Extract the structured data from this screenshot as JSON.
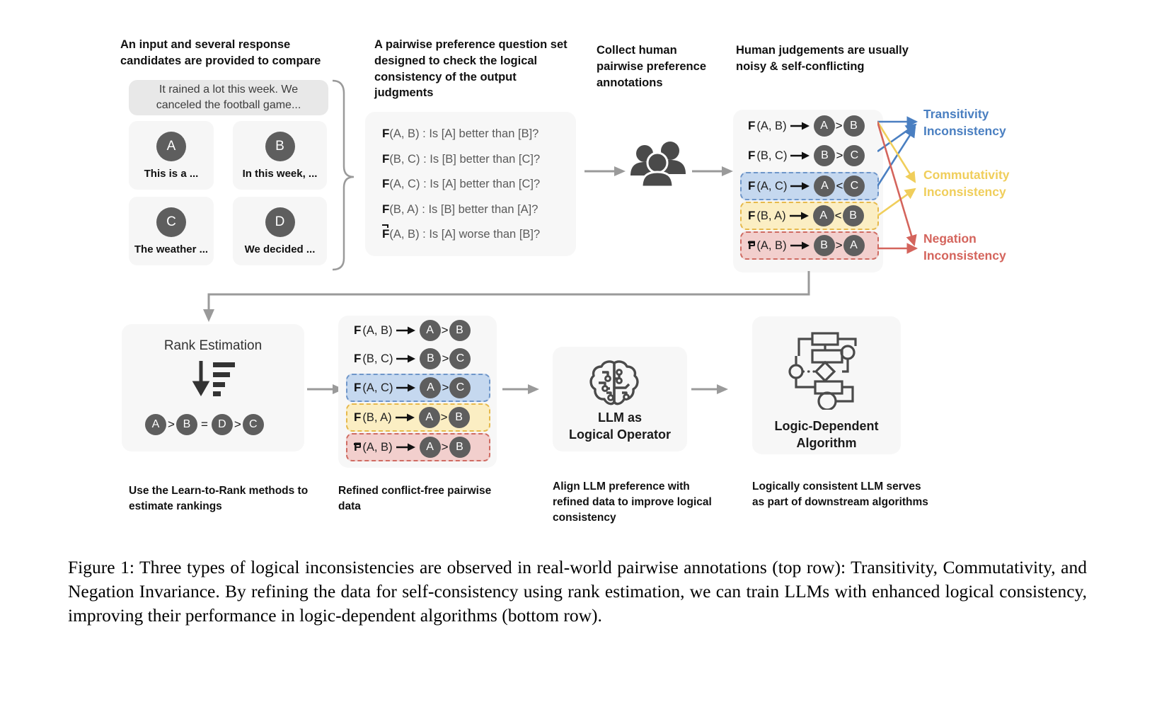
{
  "headers": {
    "input": "An input and several response candidates are provided to compare",
    "questions": "A pairwise preference question set designed to check the logical consistency of the output judgments",
    "collect": "Collect human pairwise preference annotations",
    "noisy": "Human judgements are usually noisy & self-conflicting"
  },
  "prompt": "It rained a lot this week. We canceled the football game...",
  "candidates": [
    {
      "letter": "A",
      "label": "This is a ..."
    },
    {
      "letter": "B",
      "label": "In this week, ..."
    },
    {
      "letter": "C",
      "label": "The weather ..."
    },
    {
      "letter": "D",
      "label": "We decided ..."
    }
  ],
  "question_set": [
    {
      "fn": "F",
      "negated": false,
      "args": "(A, B)",
      "sep": ":",
      "text": "Is [A] better than [B]?"
    },
    {
      "fn": "F",
      "negated": false,
      "args": "(B, C)",
      "sep": ":",
      "text": "Is [B] better than [C]?"
    },
    {
      "fn": "F",
      "negated": false,
      "args": "(A, C)",
      "sep": ":",
      "text": "Is [A] better than [C]?"
    },
    {
      "fn": "F",
      "negated": false,
      "args": "(B, A)",
      "sep": ":",
      "text": "Is [B] better than [A]?"
    },
    {
      "fn": "F",
      "negated": true,
      "args": "(A, B)",
      "sep": ":",
      "text": "Is [A] worse than [B]?"
    }
  ],
  "human_judgements": [
    {
      "fn": "F",
      "negated": false,
      "args": "(A, B)",
      "left": "A",
      "rel": ">",
      "right": "B",
      "highlight": "none"
    },
    {
      "fn": "F",
      "negated": false,
      "args": "(B, C)",
      "left": "B",
      "rel": ">",
      "right": "C",
      "highlight": "none"
    },
    {
      "fn": "F",
      "negated": false,
      "args": "(A, C)",
      "left": "A",
      "rel": "<",
      "right": "C",
      "highlight": "blue"
    },
    {
      "fn": "F",
      "negated": false,
      "args": "(B, A)",
      "left": "A",
      "rel": "<",
      "right": "B",
      "highlight": "yellow"
    },
    {
      "fn": "F",
      "negated": true,
      "args": "(A, B)",
      "left": "B",
      "rel": ">",
      "right": "A",
      "highlight": "red"
    }
  ],
  "inconsistencies": [
    {
      "line1": "Transitivity",
      "line2": "Inconsistency",
      "color": "#4a7fc1"
    },
    {
      "line1": "Commutativity",
      "line2": "Inconsistency",
      "color": "#f0ce5b"
    },
    {
      "line1": "Negation",
      "line2": "Inconsistency",
      "color": "#d4645c"
    }
  ],
  "rank_estimation": {
    "title": "Rank Estimation",
    "icon": "sort-descending-icon",
    "ranking": [
      {
        "node": "A",
        "rel": ">"
      },
      {
        "node": "B",
        "rel": "="
      },
      {
        "node": "D",
        "rel": ">"
      },
      {
        "node": "C",
        "rel": ""
      }
    ]
  },
  "refined_judgements": [
    {
      "fn": "F",
      "negated": false,
      "args": "(A, B)",
      "left": "A",
      "rel": ">",
      "right": "B",
      "highlight": "none"
    },
    {
      "fn": "F",
      "negated": false,
      "args": "(B, C)",
      "left": "B",
      "rel": ">",
      "right": "C",
      "highlight": "none"
    },
    {
      "fn": "F",
      "negated": false,
      "args": "(A, C)",
      "left": "A",
      "rel": ">",
      "right": "C",
      "highlight": "blue"
    },
    {
      "fn": "F",
      "negated": false,
      "args": "(B, A)",
      "left": "A",
      "rel": ">",
      "right": "B",
      "highlight": "yellow"
    },
    {
      "fn": "F",
      "negated": true,
      "args": "(A, B)",
      "left": "A",
      "rel": ">",
      "right": "B",
      "highlight": "red"
    }
  ],
  "llm_panel": {
    "icon": "brain-circuit-icon",
    "line1": "LLM as",
    "line2": "Logical Operator"
  },
  "algo_panel": {
    "icon": "flowchart-algorithm-icon",
    "line1": "Logic-Dependent",
    "line2": "Algorithm"
  },
  "bottom_captions": {
    "rank": "Use the Learn-to-Rank methods to estimate rankings",
    "refined": "Refined conflict-free pairwise data",
    "llm": "Align LLM preference with refined data to improve logical consistency",
    "algo": "Logically consistent LLM serves as part of downstream algorithms"
  },
  "figure_caption": "Figure 1: Three types of logical inconsistencies are observed in real-world pairwise annotations (top row): Transitivity, Commutativity, and Negation Invariance. By refining the data for self-consistency using rank estimation, we can train LLMs with enhanced logical consistency, improving their performance in logic-dependent algorithms (bottom row)."
}
